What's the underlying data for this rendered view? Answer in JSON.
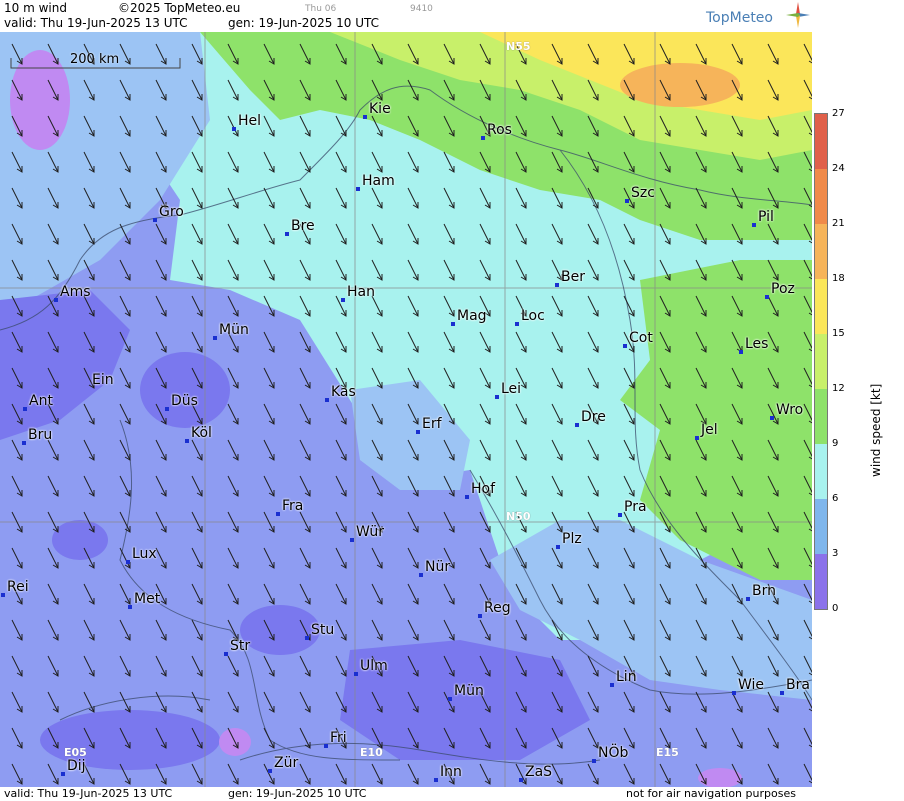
{
  "header": {
    "product": "10 m wind",
    "copyright": "©2025 TopMeteo.eu",
    "valid_line": "valid:  Thu  19-Jun-2025  13 UTC",
    "gen_line": "gen: 19-Jun-2025 10 UTC",
    "faint_day": "Thu 06",
    "faint_code": "9410",
    "logo_text": "TopMeteo"
  },
  "footer": {
    "valid_line": "valid:  Thu  19-Jun-2025  13 UTC",
    "gen_line": "gen: 19-Jun-2025 10 UTC",
    "disclaimer": "not for air navigation purposes"
  },
  "scale_bar": {
    "label": "200 km"
  },
  "grid_labels": {
    "n55": "N55",
    "n50": "N50",
    "e05": "E05",
    "e10": "E10",
    "e15": "E15"
  },
  "cities": [
    {
      "name": "Hel"
    },
    {
      "name": "Kie"
    },
    {
      "name": "Ros"
    },
    {
      "name": "Ham"
    },
    {
      "name": "Szc"
    },
    {
      "name": "Gro"
    },
    {
      "name": "Bre"
    },
    {
      "name": "Pil"
    },
    {
      "name": "Ber"
    },
    {
      "name": "Ams"
    },
    {
      "name": "Han"
    },
    {
      "name": "Poz"
    },
    {
      "name": "Mag"
    },
    {
      "name": "Loc"
    },
    {
      "name": "Mün"
    },
    {
      "name": "Cot"
    },
    {
      "name": "Les"
    },
    {
      "name": "Ein"
    },
    {
      "name": "Kas"
    },
    {
      "name": "Lei"
    },
    {
      "name": "Ant"
    },
    {
      "name": "Düs"
    },
    {
      "name": "Wro"
    },
    {
      "name": "Dre"
    },
    {
      "name": "Erf"
    },
    {
      "name": "Bru"
    },
    {
      "name": "Köl"
    },
    {
      "name": "Jel"
    },
    {
      "name": "Hof"
    },
    {
      "name": "Fra"
    },
    {
      "name": "Pra"
    },
    {
      "name": "Wür"
    },
    {
      "name": "Plz"
    },
    {
      "name": "Lux"
    },
    {
      "name": "Nür"
    },
    {
      "name": "Rei"
    },
    {
      "name": "Met"
    },
    {
      "name": "Brn"
    },
    {
      "name": "Reg"
    },
    {
      "name": "Stu"
    },
    {
      "name": "Str"
    },
    {
      "name": "Ulm"
    },
    {
      "name": "Lin"
    },
    {
      "name": "Mün"
    },
    {
      "name": "Wie"
    },
    {
      "name": "Bra"
    },
    {
      "name": "Fri"
    },
    {
      "name": "Dij"
    },
    {
      "name": "Zür"
    },
    {
      "name": "NÖb"
    },
    {
      "name": "Inn"
    },
    {
      "name": "ZaS"
    }
  ],
  "legend": {
    "title": "wind speed  [kt]",
    "ticks": [
      "27",
      "24",
      "21",
      "18",
      "15",
      "12",
      "9",
      "6",
      "3",
      "0"
    ],
    "colors": [
      "#e0604a",
      "#f08a4a",
      "#f6b45a",
      "#fbe65a",
      "#c8f06a",
      "#8ee26a",
      "#a8f2ee",
      "#7fb6ec",
      "#8b72ea",
      "#c98bf4"
    ]
  },
  "wind": {
    "direction": "north-northwest, blowing toward south-southeast"
  }
}
